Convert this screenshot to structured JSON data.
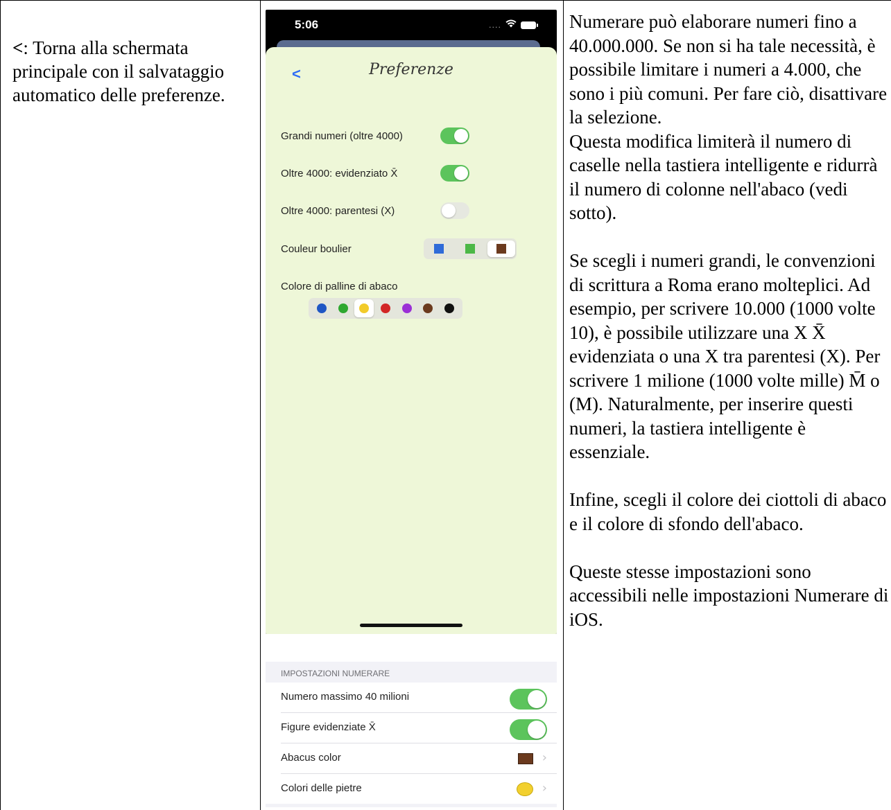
{
  "left": {
    "symbol": "<",
    "text": ": Torna alla schermata principale con il salvataggio automatico delle preferenze."
  },
  "phone": {
    "time": "5:06",
    "back": "<",
    "title": "Preferenze",
    "rows": [
      {
        "label": "Grandi numeri (oltre 4000)",
        "on": true
      },
      {
        "label": "Oltre 4000: evidenziato X̄",
        "on": true
      },
      {
        "label": "Oltre 4000: parentesi (X)",
        "on": false
      }
    ],
    "abacus_color_label": "Couleur boulier",
    "abacus_colors": [
      "#2f6bd8",
      "#4cb847",
      "#6b3a1e"
    ],
    "abacus_selected": 2,
    "beads_label": "Colore di palline di abaco",
    "bead_colors": [
      "#1f56c4",
      "#2fa830",
      "#f2cb2a",
      "#d22626",
      "#9b2fd6",
      "#6b3a1e",
      "#111111"
    ],
    "bead_selected": 2
  },
  "settings": {
    "header": "IMPOSTAZIONI NUMERARE",
    "rows": [
      {
        "label": "Numero massimo 40 milioni"
      },
      {
        "label": "Figure evidenziate X̄"
      },
      {
        "label": "Abacus color"
      },
      {
        "label": "Colori delle pietre"
      }
    ]
  },
  "right": {
    "p1": "Numerare può elaborare numeri fino a 40.000.000. Se non si ha tale necessità, è possibile limitare i numeri a 4.000, che sono i più comuni. Per fare ciò, disattivare la selezione.",
    "p2": "Questa modifica limiterà il numero di caselle nella tastiera intelligente e ridurrà il numero di colonne nell'abaco (vedi sotto).",
    "p3": "Se scegli i numeri grandi, le convenzioni di scrittura a Roma erano molteplici. Ad esempio, per scrivere 10.000 (1000 volte 10), è possibile utilizzare una X X̄ evidenziata o una X tra parentesi (X). Per scrivere 1 milione (1000 volte mille) M̄ o (M). Naturalmente, per inserire questi numeri, la tastiera intelligente è essenziale.",
    "p4": "Infine, scegli il colore dei ciottoli di abaco e il colore di sfondo dell'abaco.",
    "p5": "Queste stesse impostazioni sono accessibili nelle impostazioni Numerare di iOS."
  }
}
